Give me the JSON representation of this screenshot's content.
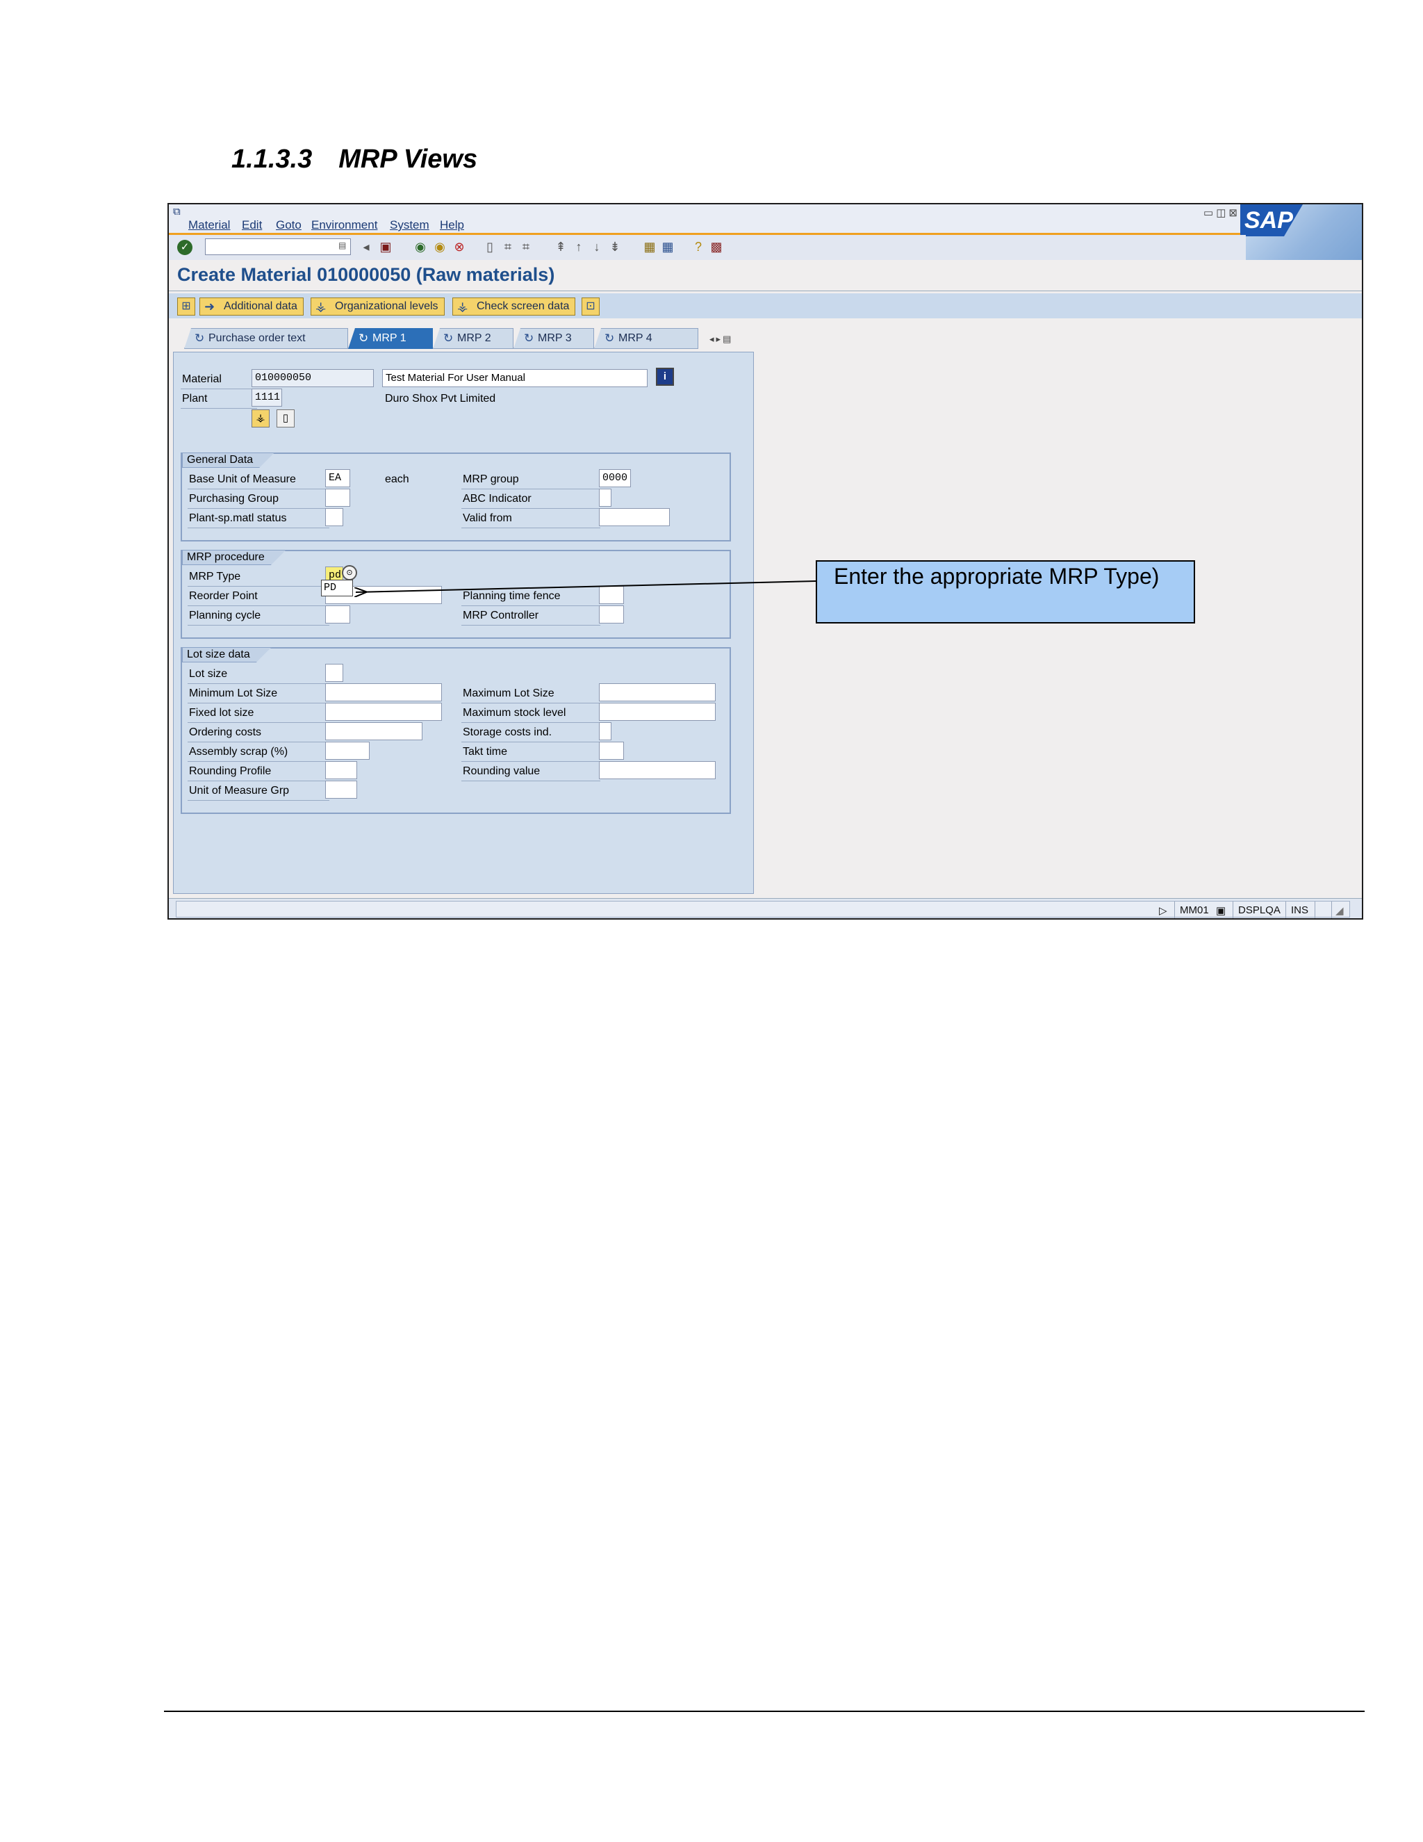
{
  "document": {
    "heading_number": "1.1.3.3",
    "heading_title": "MRP Views"
  },
  "menu": {
    "items": [
      "Material",
      "Edit",
      "Goto",
      "Environment",
      "System",
      "Help"
    ]
  },
  "sap_logo": "SAP",
  "screen_title": "Create Material 010000050 (Raw materials)",
  "app_toolbar": {
    "additional_data": "Additional data",
    "organizational_levels": "Organizational levels",
    "check_screen_data": "Check screen data"
  },
  "tabs": [
    {
      "label": "Purchase order text",
      "active": false
    },
    {
      "label": "MRP 1",
      "active": true
    },
    {
      "label": "MRP 2",
      "active": false
    },
    {
      "label": "MRP 3",
      "active": false
    },
    {
      "label": "MRP 4",
      "active": false
    }
  ],
  "header": {
    "material_label": "Material",
    "material_value": "010000050",
    "material_desc": "Test Material For User Manual",
    "plant_label": "Plant",
    "plant_value": "1111",
    "plant_desc": "Duro Shox Pvt Limited"
  },
  "general_data": {
    "title": "General Data",
    "base_uom_label": "Base Unit of Measure",
    "base_uom_value": "EA",
    "base_uom_text": "each",
    "purchasing_group_label": "Purchasing Group",
    "plant_status_label": "Plant-sp.matl status",
    "mrp_group_label": "MRP group",
    "mrp_group_value": "0000",
    "abc_label": "ABC Indicator",
    "valid_from_label": "Valid from"
  },
  "mrp_procedure": {
    "title": "MRP procedure",
    "mrp_type_label": "MRP Type",
    "mrp_type_value": "pd",
    "mrp_type_dropdown": "PD",
    "reorder_point_label": "Reorder Point",
    "planning_cycle_label": "Planning cycle",
    "planning_fence_label": "Planning time fence",
    "mrp_controller_label": "MRP Controller"
  },
  "lot_size": {
    "title": "Lot size data",
    "lot_size_label": "Lot size",
    "min_lot_label": "Minimum Lot Size",
    "fixed_lot_label": "Fixed lot size",
    "ordering_costs_label": "Ordering costs",
    "assembly_scrap_label": "Assembly scrap (%)",
    "rounding_profile_label": "Rounding Profile",
    "uom_grp_label": "Unit of Measure Grp",
    "max_lot_label": "Maximum Lot Size",
    "max_stock_label": "Maximum stock level",
    "storage_costs_label": "Storage costs ind.",
    "takt_label": "Takt time",
    "rounding_value_label": "Rounding value"
  },
  "status_bar": {
    "transaction": "MM01",
    "system": "DSPLQA",
    "mode": "INS"
  },
  "callout": {
    "text": "Enter the appropriate MRP Type)"
  },
  "colors": {
    "title_blue": "#1f4f8c",
    "active_tab": "#2c6fb8",
    "button_yellow": "#f4d36b",
    "callout_fill": "#a6ccf5",
    "mrp_type_highlight": "#f7ee79"
  }
}
